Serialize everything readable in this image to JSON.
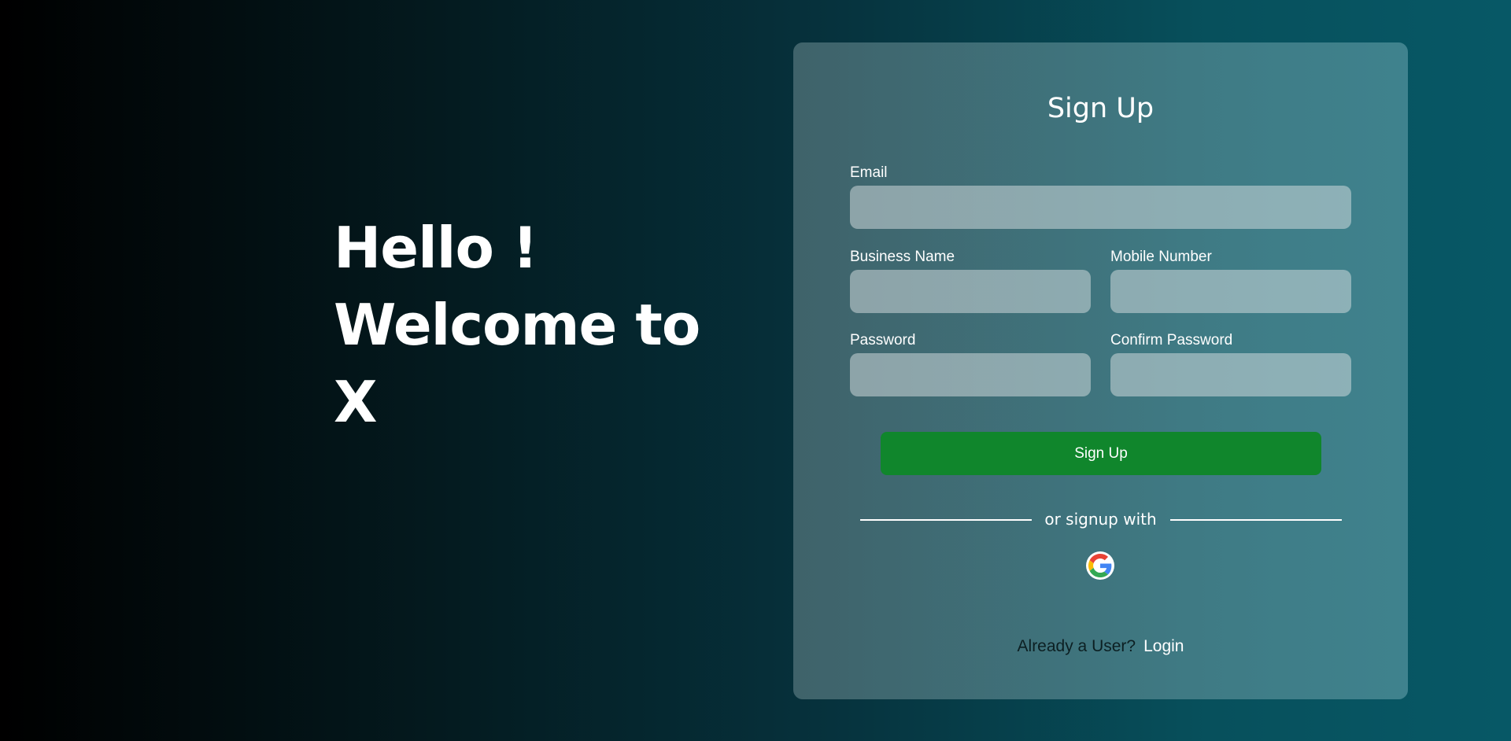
{
  "hero": {
    "line1": "Hello !",
    "line2": "Welcome to",
    "line3": "X"
  },
  "form": {
    "title": "Sign Up",
    "email_label": "Email",
    "email_value": "",
    "business_label": "Business Name",
    "business_value": "",
    "mobile_label": "Mobile Number",
    "mobile_value": "",
    "password_label": "Password",
    "password_value": "",
    "confirm_label": "Confirm Password",
    "confirm_value": "",
    "submit_label": "Sign Up",
    "divider_text": "or signup with",
    "social_icon": "google-icon",
    "footer_question": "Already a User?",
    "footer_link": "Login"
  },
  "colors": {
    "button": "#10862c",
    "text": "#ffffff"
  }
}
